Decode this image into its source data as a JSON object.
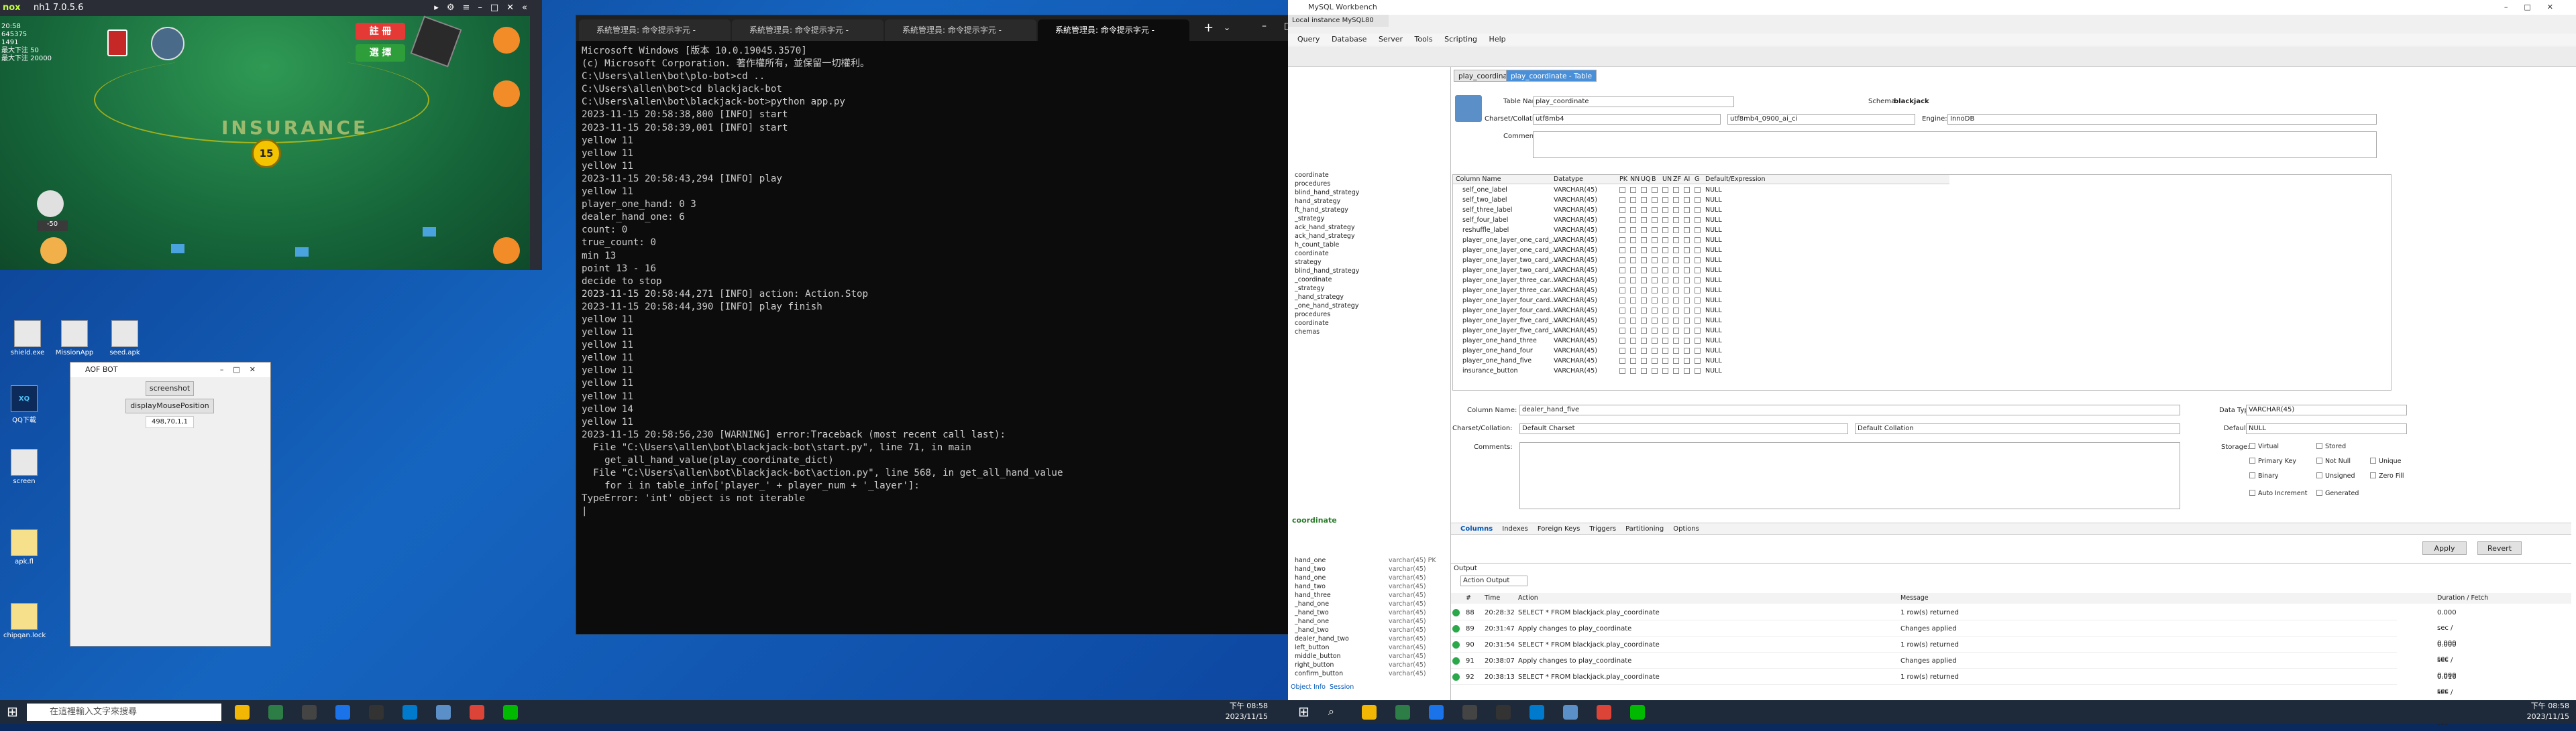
{
  "nox": {
    "title": "nh1 7.0.5.6",
    "stats": [
      "20:58",
      "645375",
      "1491",
      "最大下注 50",
      "最大下注 20000"
    ],
    "btn_register": "註 冊",
    "btn_choose": "選 擇",
    "timer": "15",
    "bet_value": "-50",
    "felt_text": "INSURANCE"
  },
  "desktop": {
    "icons": [
      "shield.exe",
      "MissionApp",
      "seed.apk",
      "QQ下載",
      "screen",
      "apk.fl",
      "chipqan.lock"
    ]
  },
  "aofbot": {
    "title": "AOF BOT",
    "screenshot_label": "screenshot",
    "mouse_label": "displayMousePosition",
    "coords": "498,70,1,1"
  },
  "terminal": {
    "tabs": [
      "系統管理員: 命令提示字元 -",
      "系統管理員: 命令提示字元 -",
      "系統管理員: 命令提示字元 -",
      "系統管理員: 命令提示字元 -"
    ],
    "lines": [
      "Microsoft Windows [版本 10.0.19045.3570]",
      "(c) Microsoft Corporation. 著作權所有，並保留一切權利。",
      "",
      "C:\\Users\\allen\\bot\\plo-bot>cd ..",
      "",
      "C:\\Users\\allen\\bot>cd blackjack-bot",
      "",
      "C:\\Users\\allen\\bot\\blackjack-bot>python app.py",
      "2023-11-15 20:58:38,800 [INFO] start",
      "2023-11-15 20:58:39,001 [INFO] start",
      "yellow 11",
      "yellow 11",
      "yellow 11",
      "2023-11-15 20:58:43,294 [INFO] play",
      "yellow 11",
      "player_one_hand: 0 3",
      "dealer_hand_one: 6",
      "count: 0",
      "true_count: 0",
      "min 13",
      "point 13 - 16",
      "decide to stop",
      "2023-11-15 20:58:44,271 [INFO] action: Action.Stop",
      "2023-11-15 20:58:44,390 [INFO] play finish",
      "yellow 11",
      "yellow 11",
      "yellow 11",
      "yellow 11",
      "yellow 11",
      "yellow 11",
      "yellow 11",
      "yellow 14",
      "yellow 11",
      "2023-11-15 20:58:56,230 [WARNING] error:Traceback (most recent call last):",
      "  File \"C:\\Users\\allen\\bot\\blackjack-bot\\start.py\", line 71, in main",
      "    get_all_hand_value(play_coordinate_dict)",
      "  File \"C:\\Users\\allen\\bot\\blackjack-bot\\action.py\", line 568, in get_all_hand_value",
      "    for i in table_info['player_' + player_num + '_layer']:",
      "TypeError: 'int' object is not iterable",
      "",
      "|"
    ]
  },
  "workbench": {
    "title": "MySQL Workbench",
    "conn_tab": "Local instance MySQL80",
    "menu": [
      "Query",
      "Database",
      "Server",
      "Tools",
      "Scripting",
      "Help"
    ],
    "tabs": [
      "play_coordinate",
      "play_coordinate - Table"
    ],
    "table_name_label": "Table Name:",
    "table_name": "play_coordinate",
    "schema_label": "Schema:",
    "schema": "blackjack",
    "charset_label": "Charset/Collation:",
    "charset": "utf8mb4",
    "collation": "utf8mb4_0900_ai_ci",
    "engine_label": "Engine:",
    "engine": "InnoDB",
    "comments_label": "Comments:",
    "grid_headers": [
      "Column Name",
      "Datatype",
      "PK",
      "NN",
      "UQ",
      "B",
      "UN",
      "ZF",
      "AI",
      "G",
      "Default/Expression"
    ],
    "columns": [
      "self_one_label",
      "self_two_label",
      "self_three_label",
      "self_four_label",
      "reshuffle_label",
      "player_one_layer_one_card_...",
      "player_one_layer_one_card_...",
      "player_one_layer_two_card_...",
      "player_one_layer_two_card_...",
      "player_one_layer_three_car...",
      "player_one_layer_three_car...",
      "player_one_layer_four_card...",
      "player_one_layer_four_card...",
      "player_one_layer_five_card_...",
      "player_one_layer_five_card_...",
      "player_one_hand_three",
      "player_one_hand_four",
      "player_one_hand_five",
      "insurance_button"
    ],
    "datatype": "VARCHAR(45)",
    "default": "NULL",
    "col_name_label": "Column Name:",
    "col_name": "dealer_hand_five",
    "data_type_label": "Data Type:",
    "data_type": "VARCHAR(45)",
    "col_charset": "Default Charset",
    "col_collation": "Default Collation",
    "default_label": "Default:",
    "default_value": "NULL",
    "storage_label": "Storage:",
    "options": [
      "Virtual",
      "Stored",
      "Primary Key",
      "Not Null",
      "Unique",
      "Binary",
      "Unsigned",
      "Zero Fill",
      "Auto Increment",
      "Generated"
    ],
    "bottom_tabs": [
      "Columns",
      "Indexes",
      "Foreign Keys",
      "Triggers",
      "Partitioning",
      "Options"
    ],
    "apply": "Apply",
    "revert": "Revert",
    "output_label": "Output",
    "action_output": "Action Output",
    "out_headers": [
      "#",
      "Time",
      "Action",
      "Message",
      "Duration / Fetch"
    ],
    "out_rows": [
      {
        "n": "88",
        "t": "20:28:32",
        "a": "SELECT * FROM blackjack.play_coordinate",
        "m": "1 row(s) returned",
        "d": "0.000 sec / 0.000 sec"
      },
      {
        "n": "89",
        "t": "20:31:47",
        "a": "Apply changes to play_coordinate",
        "m": "Changes applied",
        "d": ""
      },
      {
        "n": "90",
        "t": "20:31:54",
        "a": "SELECT * FROM blackjack.play_coordinate",
        "m": "1 row(s) returned",
        "d": "0.000 sec / 0.000 sec"
      },
      {
        "n": "91",
        "t": "20:38:07",
        "a": "Apply changes to play_coordinate",
        "m": "Changes applied",
        "d": ""
      },
      {
        "n": "92",
        "t": "20:38:13",
        "a": "SELECT * FROM blackjack.play_coordinate",
        "m": "1 row(s) returned",
        "d": "0.016 sec / 0.000 sec"
      }
    ],
    "nav_items": [
      "coordinate",
      "procedures",
      "blind_hand_strategy",
      "hand_strategy",
      "ft_hand_strategy",
      "_strategy",
      "ack_hand_strategy",
      "ack_hand_strategy",
      "h_count_table",
      "coordinate",
      "strategy",
      "blind_hand_strategy",
      "_coordinate",
      "_strategy",
      "_hand_strategy",
      "_one_hand_strategy",
      "procedures",
      "coordinate",
      "chemas"
    ],
    "info_title": "coordinate",
    "info_rows": [
      "hand_one",
      "hand_two",
      "hand_one",
      "hand_two",
      "hand_three",
      "_hand_one",
      "_hand_two",
      "_hand_one",
      "_hand_two",
      "dealer_hand_two",
      "left_button",
      "middle_button",
      "right_button",
      "confirm_button"
    ],
    "info_type": "varchar(45)",
    "info_pk": "varchar(45) PK",
    "info_tabs": [
      "Object Info",
      "Session"
    ]
  },
  "taskbar": {
    "search_placeholder": "在這裡輸入文字來搜尋",
    "time": "下午 08:58",
    "date": "2023/11/15"
  }
}
